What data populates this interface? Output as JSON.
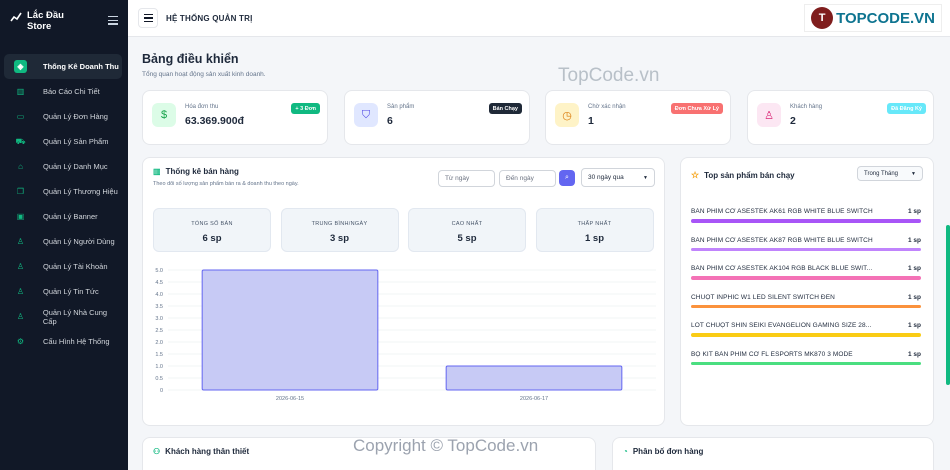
{
  "sidebar": {
    "brand": "Lắc Đầu Store",
    "items": [
      {
        "label": "Thống Kê Doanh Thu",
        "icon": "cube-icon",
        "active": true
      },
      {
        "label": "Báo Cáo Chi Tiết",
        "icon": "bar-chart-icon"
      },
      {
        "label": "Quản Lý Đơn Hàng",
        "icon": "card-icon"
      },
      {
        "label": "Quản Lý Sản Phẩm",
        "icon": "cart-icon"
      },
      {
        "label": "Quản Lý Danh Mục",
        "icon": "tag-icon"
      },
      {
        "label": "Quản Lý Thương Hiệu",
        "icon": "copy-icon"
      },
      {
        "label": "Quản Lý Banner",
        "icon": "image-icon"
      },
      {
        "label": "Quản Lý Người Dùng",
        "icon": "user-icon"
      },
      {
        "label": "Quản Lý Tài Khoản",
        "icon": "user-icon"
      },
      {
        "label": "Quản Lý Tin Tức",
        "icon": "user-icon"
      },
      {
        "label": "Quản Lý Nhà Cung Cấp",
        "icon": "truck-icon"
      },
      {
        "label": "Cấu Hình Hệ Thống",
        "icon": "gear-icon"
      }
    ]
  },
  "header": {
    "title": "HỆ THỐNG QUẢN TRỊ",
    "logo_text": "TOPCODE.VN"
  },
  "page": {
    "title": "Bảng điều khiển",
    "subtitle": "Tổng quan hoạt động sản xuất kinh doanh.",
    "watermark": "TopCode.vn",
    "copyright": "Copyright © TopCode.vn"
  },
  "stats": [
    {
      "label": "Hóa đơn thu",
      "value": "63.369.900đ",
      "badge": "+ 3 Đơn",
      "badge_color": "#10b981",
      "icon": "cash-icon",
      "icon_bg": "#dcfce7",
      "icon_color": "#16a34a"
    },
    {
      "label": "Sản phẩm",
      "value": "6",
      "badge": "Bán Chạy",
      "badge_color": "#1f2937",
      "icon": "bag-icon",
      "icon_bg": "#e0e7ff",
      "icon_color": "#4f46e5"
    },
    {
      "label": "Chờ xác nhận",
      "value": "1",
      "badge": "Đơn Chưa Xử Lý",
      "badge_color": "#f87171",
      "icon": "clock-icon",
      "icon_bg": "#fef3c7",
      "icon_color": "#d97706"
    },
    {
      "label": "Khách hàng",
      "value": "2",
      "badge": "Đã Đăng Ký",
      "badge_color": "#67e8f9",
      "icon": "user-plus-icon",
      "icon_bg": "#fce7f3",
      "icon_color": "#db2777"
    }
  ],
  "sales_panel": {
    "title": "Thống kê bán hàng",
    "subtitle": "Theo dõi số lượng sản phẩm bán ra & doanh thu theo ngày.",
    "from_placeholder": "Từ ngày",
    "to_placeholder": "Đến ngày",
    "range": "30 ngày qua",
    "summary": [
      {
        "label": "TỔNG SỐ BÁN",
        "value": "6 sp"
      },
      {
        "label": "TRUNG BÌNH/NGÀY",
        "value": "3 sp"
      },
      {
        "label": "CAO NHẤT",
        "value": "5 sp"
      },
      {
        "label": "THẤP NHẤT",
        "value": "1 sp"
      }
    ]
  },
  "chart_data": {
    "type": "bar",
    "categories": [
      "2026-06-15",
      "2026-06-17"
    ],
    "values": [
      5,
      1
    ],
    "ylim": [
      0,
      5
    ],
    "yticks": [
      "0",
      "0.5",
      "1.0",
      "1.5",
      "2.0",
      "2.5",
      "3.0",
      "3.5",
      "4.0",
      "4.5",
      "5.0"
    ],
    "color": "#c7caf5",
    "stroke": "#6366f1",
    "grid": true
  },
  "top_products": {
    "title": "Top sản phẩm bán chạy",
    "filter": "Trong Tháng",
    "items": [
      {
        "name": "BÀN PHÍM CƠ ASESTEK AK61 RGB WHITE BLUE SWITCH",
        "qty": "1 sp",
        "color": "#a855f7"
      },
      {
        "name": "BÀN PHÍM CƠ ASESTEK AK87 RGB WHITE BLUE SWITCH",
        "qty": "1 sp",
        "color": "#c084fc"
      },
      {
        "name": "BÀN PHÍM CƠ ASESTEK AK104 RGB BLACK BLUE SWIT...",
        "qty": "1 sp",
        "color": "#f472b6"
      },
      {
        "name": "CHUỘT INPHIC W1 LED SILENT SWITCH ĐEN",
        "qty": "1 sp",
        "color": "#fb923c"
      },
      {
        "name": "LÓT CHUỘT SHIN SEIKI EVANGELION GAMING SIZE 28...",
        "qty": "1 sp",
        "color": "#facc15"
      },
      {
        "name": "BỘ KIT BÀN PHÍM CƠ FL ESPORTS MK870 3 MODE",
        "qty": "1 sp",
        "color": "#4ade80"
      }
    ]
  },
  "bottom": {
    "loyal_title": "Khách hàng thân thiết",
    "orders_title": "Phân bố đơn hàng"
  }
}
